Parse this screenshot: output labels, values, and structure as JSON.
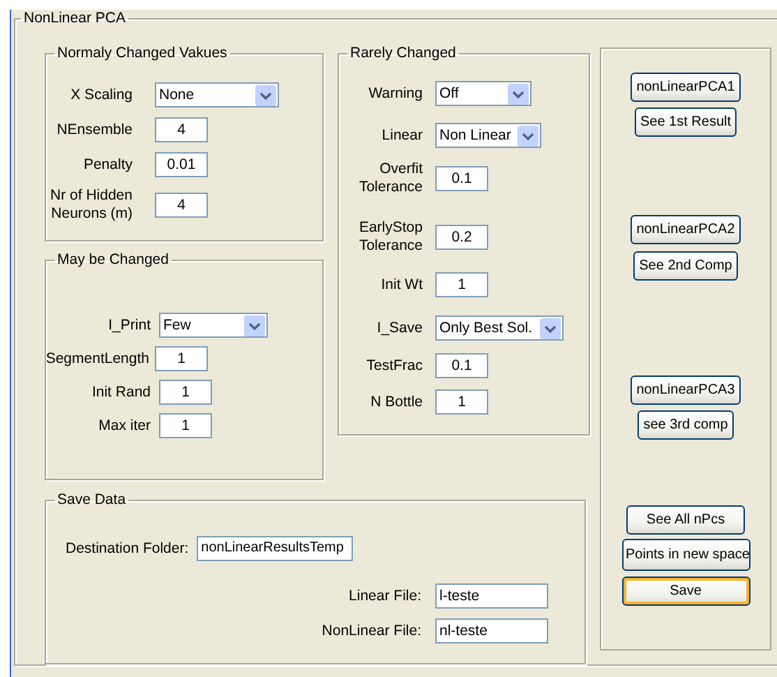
{
  "panel": {
    "title": "NonLinear PCA"
  },
  "groups": [
    {
      "kind": "normal",
      "title": "Normaly Changed Vakues",
      "fields": [
        {
          "label": "X Scaling",
          "kind": "select",
          "value": "None"
        },
        {
          "label": "NEnsemble",
          "kind": "input",
          "value": "4"
        },
        {
          "label": "Penalty",
          "kind": "input",
          "value": "0.01"
        },
        {
          "label": "Nr of Hidden Neurons (m)",
          "kind": "input",
          "value": "4"
        }
      ]
    },
    {
      "kind": "maybe",
      "title": "May be Changed",
      "fields": [
        {
          "label": "I_Print",
          "kind": "select",
          "value": "Few"
        },
        {
          "label": "SegmentLength",
          "kind": "input",
          "value": "1"
        },
        {
          "label": "Init Rand",
          "kind": "input",
          "value": "1"
        },
        {
          "label": "Max iter",
          "kind": "input",
          "value": "1"
        }
      ]
    },
    {
      "kind": "rare",
      "title": "Rarely Changed",
      "fields": [
        {
          "label": "Warning",
          "kind": "select",
          "value": "Off"
        },
        {
          "label": "Linear",
          "kind": "select",
          "value": "Non Linear"
        },
        {
          "label": "Overfit Tolerance",
          "kind": "input",
          "value": "0.1"
        },
        {
          "label": "EarlyStop Tolerance",
          "kind": "input",
          "value": "0.2"
        },
        {
          "label": "Init Wt",
          "kind": "input",
          "value": "1"
        },
        {
          "label": "I_Save",
          "kind": "select",
          "value": "Only Best Sol."
        },
        {
          "label": "TestFrac",
          "kind": "input",
          "value": "0.1"
        },
        {
          "label": "N Bottle",
          "kind": "input",
          "value": "1"
        }
      ]
    }
  ],
  "save_data": {
    "title": "Save Data",
    "destination": {
      "label": "Destination Folder:",
      "value": "nonLinearResultsTemp"
    },
    "files": [
      {
        "label": "Linear File:",
        "value": "l-teste"
      },
      {
        "label": "NonLinear File:",
        "value": "nl-teste"
      }
    ]
  },
  "buttons": [
    {
      "label": "nonLinearPCA1",
      "default": false
    },
    {
      "label": "See 1st Result",
      "default": false
    },
    {
      "label": "nonLinearPCA2",
      "default": false
    },
    {
      "label": "See 2nd Comp",
      "default": false
    },
    {
      "label": "nonLinearPCA3",
      "default": false
    },
    {
      "label": "see 3rd comp",
      "default": false
    },
    {
      "label": "See All nPcs",
      "default": false
    },
    {
      "label": "Points in new space",
      "default": false
    },
    {
      "label": "Save",
      "default": true
    }
  ]
}
